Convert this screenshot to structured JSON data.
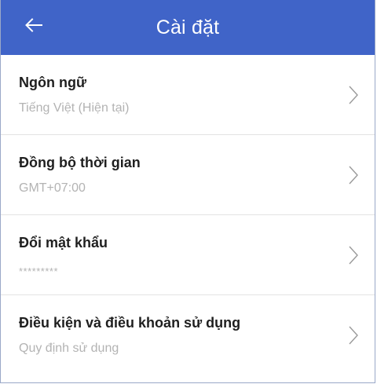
{
  "header": {
    "title": "Cài đặt",
    "back_icon": "arrow-left-icon",
    "background_color": "#4064c8"
  },
  "settings": [
    {
      "title": "Ngôn ngữ",
      "subtitle": "Tiếng Việt (Hiện tại)"
    },
    {
      "title": "Đồng bộ thời gian",
      "subtitle": "GMT+07:00"
    },
    {
      "title": "Đổi mật khẩu",
      "subtitle": "*********"
    },
    {
      "title": "Điều kiện và điều khoản sử dụng",
      "subtitle": "Quy định sử dụng"
    }
  ],
  "row_icon": "chevron-right-icon"
}
